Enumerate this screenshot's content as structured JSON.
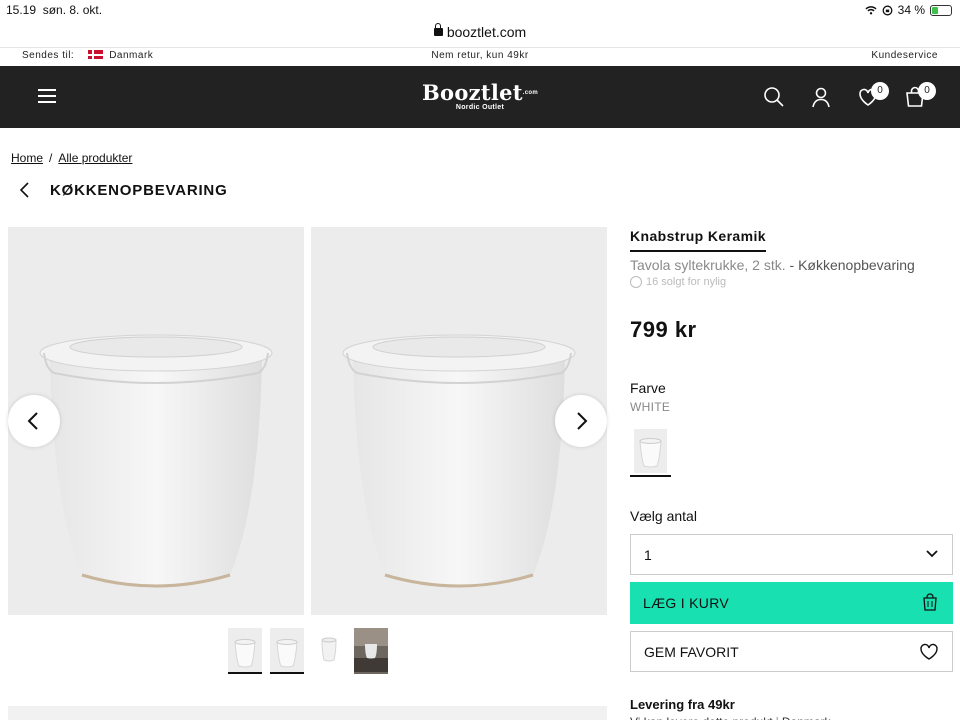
{
  "status_bar": {
    "time": "15.19",
    "date": "søn. 8. okt.",
    "battery": "34 %",
    "battery_level": 0.34
  },
  "url_bar": {
    "domain": "booztlet.com"
  },
  "info_strip": {
    "ship_label": "Sendes til:",
    "country": "Danmark",
    "returns": "Nem retur, kun 49kr",
    "service": "Kundeservice"
  },
  "header": {
    "logo": "Booztlet",
    "logo_suffix": ".com",
    "logo_tagline": "Nordic Outlet",
    "wishlist_count": "0",
    "cart_count": "0",
    "icons": [
      "menu-icon",
      "search-icon",
      "account-icon",
      "heart-icon",
      "bag-icon"
    ]
  },
  "breadcrumb": {
    "home": "Home",
    "separator": "/",
    "all_products": "Alle produkter"
  },
  "category_title": "KØKKENOPBEVARING",
  "product": {
    "brand": "Knabstrup Keramik",
    "name": "Tavola syltekrukke, 2 stk.",
    "name_separator": " - ",
    "category": "Køkkenopbevaring",
    "sold_recently": "16 solgt for nylig",
    "price": "799 kr",
    "color_label": "Farve",
    "color_value": "WHITE",
    "quantity_label": "Vælg antal",
    "quantity_value": "1",
    "add_to_cart": "LÆG I KURV",
    "favorite": "GEM FAVORIT",
    "delivery_title": "Levering fra 49kr",
    "delivery_text": "Vi kan levere dette produkt i Danmark."
  },
  "colors": {
    "accent": "#19e0b0",
    "header_bg": "#222222"
  }
}
